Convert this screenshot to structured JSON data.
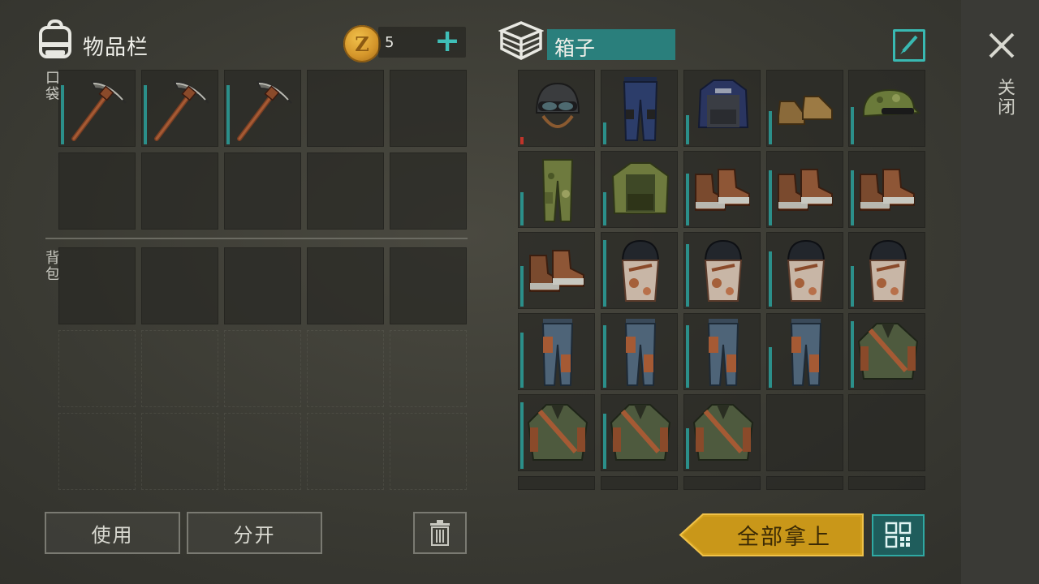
{
  "inventory": {
    "title": "物品栏",
    "coins": "5",
    "coin_symbol": "Z",
    "pocket_label": "口袋",
    "backpack_label": "背包",
    "pocket_slots": [
      "pickaxe",
      "pickaxe",
      "pickaxe",
      "",
      "",
      "",
      "",
      "",
      "",
      ""
    ],
    "backpack_slots": [
      "",
      "",
      "",
      "",
      ""
    ]
  },
  "buttons": {
    "use": "使用",
    "split": "分开",
    "take_all": "全部拿上"
  },
  "container": {
    "title": "箱子",
    "slots": [
      {
        "item": "helmet-goggles",
        "durability": 0.1,
        "low": true
      },
      {
        "item": "police-pants",
        "durability": 0.3
      },
      {
        "item": "police-vest",
        "durability": 0.4
      },
      {
        "item": "leather-shoes",
        "durability": 0.45
      },
      {
        "item": "camo-cap",
        "durability": 0.5
      },
      {
        "item": "camo-pants",
        "durability": 0.45
      },
      {
        "item": "camo-vest",
        "durability": 0.45
      },
      {
        "item": "rusty-boots",
        "durability": 0.7
      },
      {
        "item": "rusty-boots",
        "durability": 0.75
      },
      {
        "item": "rusty-boots",
        "durability": 0.75
      },
      {
        "item": "rusty-boots",
        "durability": 0.55
      },
      {
        "item": "rusty-helmet",
        "durability": 0.9
      },
      {
        "item": "rusty-helmet",
        "durability": 0.85
      },
      {
        "item": "rusty-helmet",
        "durability": 0.75
      },
      {
        "item": "rusty-helmet",
        "durability": 0.55
      },
      {
        "item": "rusty-pants",
        "durability": 0.75
      },
      {
        "item": "rusty-pants",
        "durability": 0.85
      },
      {
        "item": "rusty-pants",
        "durability": 0.85
      },
      {
        "item": "rusty-pants",
        "durability": 0.55
      },
      {
        "item": "rusty-jacket",
        "durability": 0.9
      },
      {
        "item": "rusty-jacket",
        "durability": 0.9
      },
      {
        "item": "rusty-jacket",
        "durability": 0.75
      },
      {
        "item": "rusty-jacket",
        "durability": 0.55
      },
      {
        "item": "",
        "durability": 0
      },
      {
        "item": "",
        "durability": 0
      }
    ]
  },
  "side": {
    "close_label": "关闭"
  },
  "colors": {
    "accent": "#2fa9a3",
    "take_all": "#d4a21e",
    "durability": "#2b8f8a",
    "durability_low": "#c0342a"
  }
}
